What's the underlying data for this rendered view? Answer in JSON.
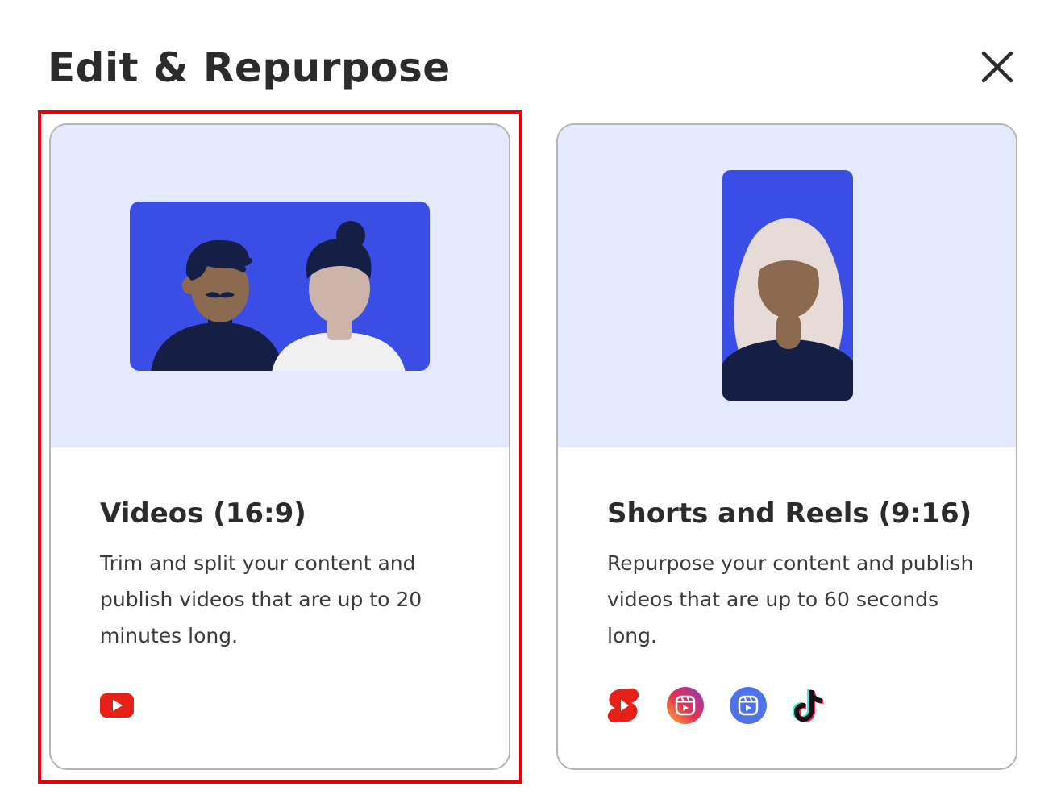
{
  "modal": {
    "title": "Edit & Repurpose",
    "close_label": "Close"
  },
  "cards": [
    {
      "id": "videos",
      "title": "Videos (16:9)",
      "description": "Trim and split your content and publish videos that are up to 20 minutes long.",
      "platforms": [
        "youtube-icon"
      ],
      "selected": true
    },
    {
      "id": "shorts",
      "title": "Shorts and Reels (9:16)",
      "description": "Repurpose your content and publish videos that are up to 60 seconds long.",
      "platforms": [
        "youtube-shorts-icon",
        "instagram-reels-icon",
        "facebook-reels-icon",
        "tiktok-icon"
      ],
      "selected": false
    }
  ],
  "colors": {
    "accent_blue": "#3a4ee6",
    "illustration_bg": "#e5e9fd",
    "selection_red": "#e8000b",
    "youtube_red": "#e62117",
    "navy": "#151e45"
  }
}
